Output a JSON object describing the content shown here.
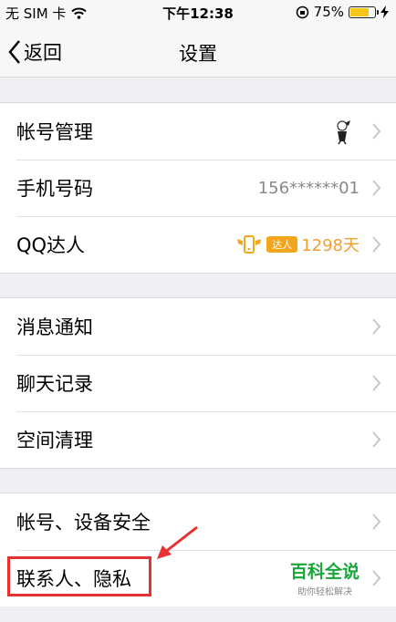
{
  "status_bar": {
    "carrier": "无 SIM 卡",
    "time": "下午12:38",
    "battery": "75%",
    "battery_level": 0.75
  },
  "nav": {
    "back_label": "返回",
    "title": "设置"
  },
  "groups": [
    {
      "items": [
        {
          "label": "帐号管理"
        },
        {
          "label": "手机号码",
          "value": "156******01"
        },
        {
          "label": "QQ达人",
          "badge": "达人",
          "days": "1298天"
        }
      ]
    },
    {
      "items": [
        {
          "label": "消息通知"
        },
        {
          "label": "聊天记录"
        },
        {
          "label": "空间清理"
        }
      ]
    },
    {
      "items": [
        {
          "label": "帐号、设备安全"
        },
        {
          "label": "联系人、隐私"
        }
      ]
    }
  ],
  "watermark": {
    "main": "百科全说",
    "sub": "助你轻松解决"
  },
  "colors": {
    "highlight": "#e83030",
    "watermark": "#1aa53a",
    "badge": "#f3a51c"
  }
}
